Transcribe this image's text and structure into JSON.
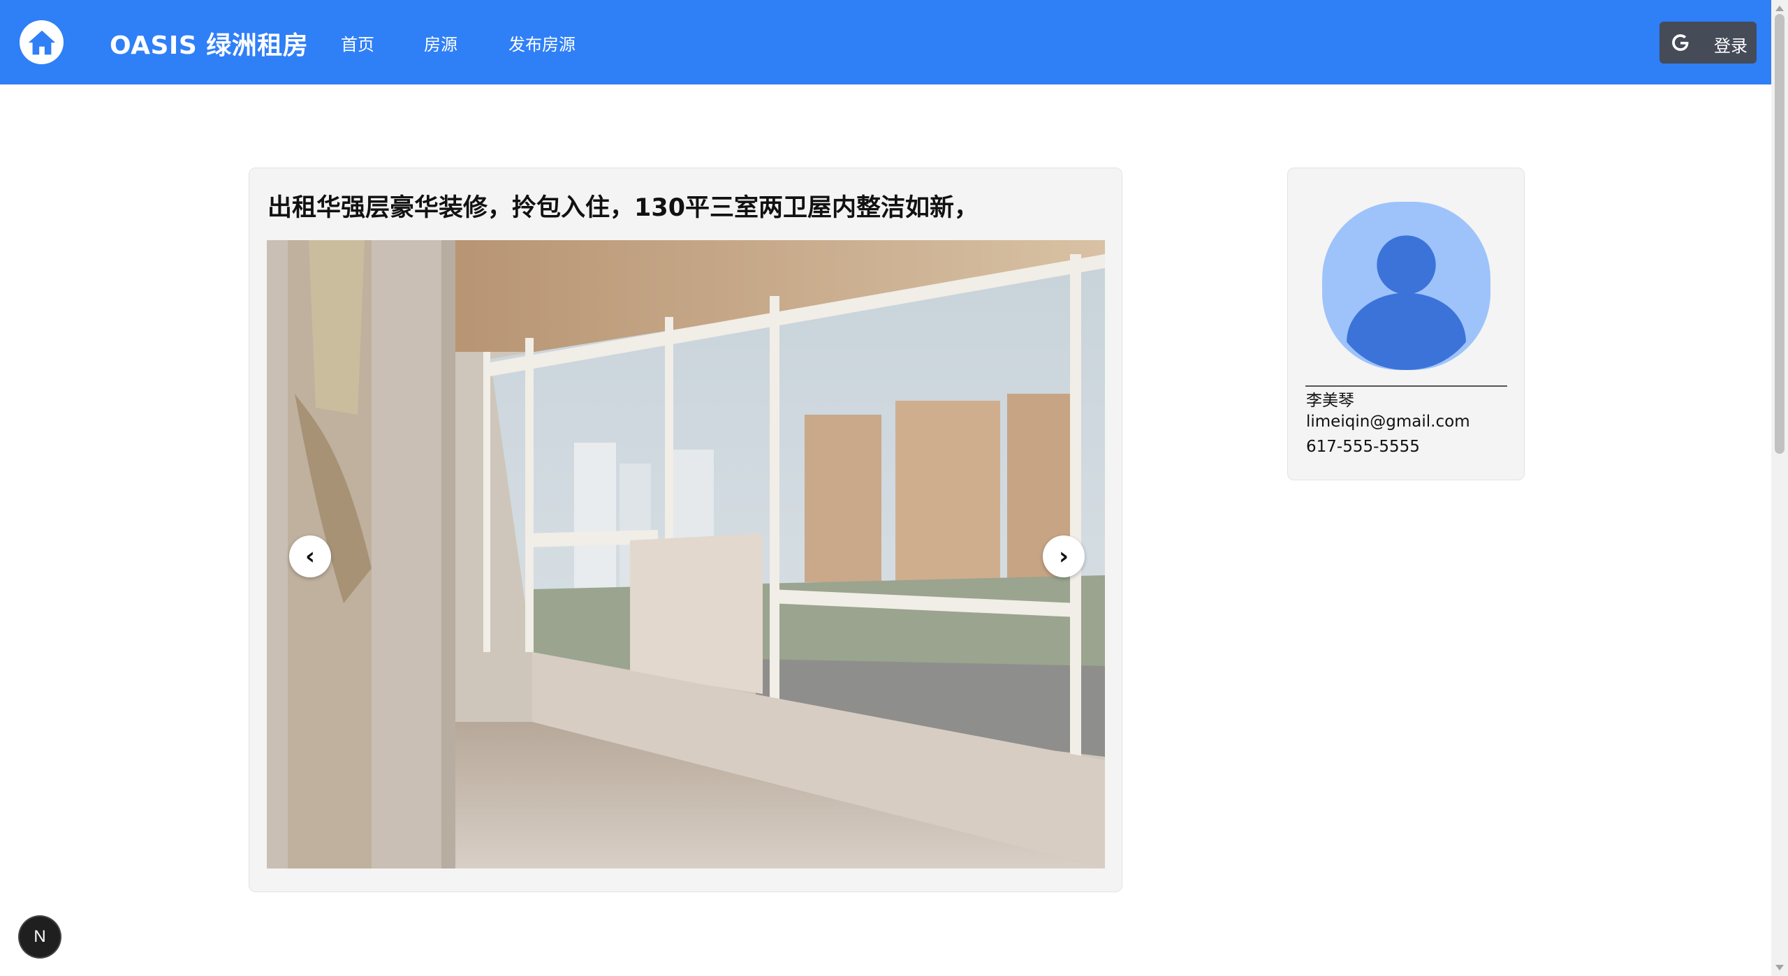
{
  "header": {
    "brand": "OASIS 绿洲租房",
    "nav": [
      {
        "label": "首页"
      },
      {
        "label": "房源"
      },
      {
        "label": "发布房源"
      }
    ],
    "login_label": "登录",
    "logo_icon": "home-icon",
    "login_icon": "google-icon",
    "accent_color": "#2f7ff7"
  },
  "listing": {
    "title": "出租华强层豪华装修，拎包入住，130平三室两卫屋内整洁如新，",
    "image_description_icon": "apartment-photo",
    "prev_symbol": "‹",
    "next_symbol": "›"
  },
  "owner": {
    "name": "李美琴",
    "email": "limeiqin@gmail.com",
    "phone": "617-555-5555",
    "avatar_icon": "user-avatar-icon"
  },
  "dev_badge": {
    "label": "N"
  }
}
